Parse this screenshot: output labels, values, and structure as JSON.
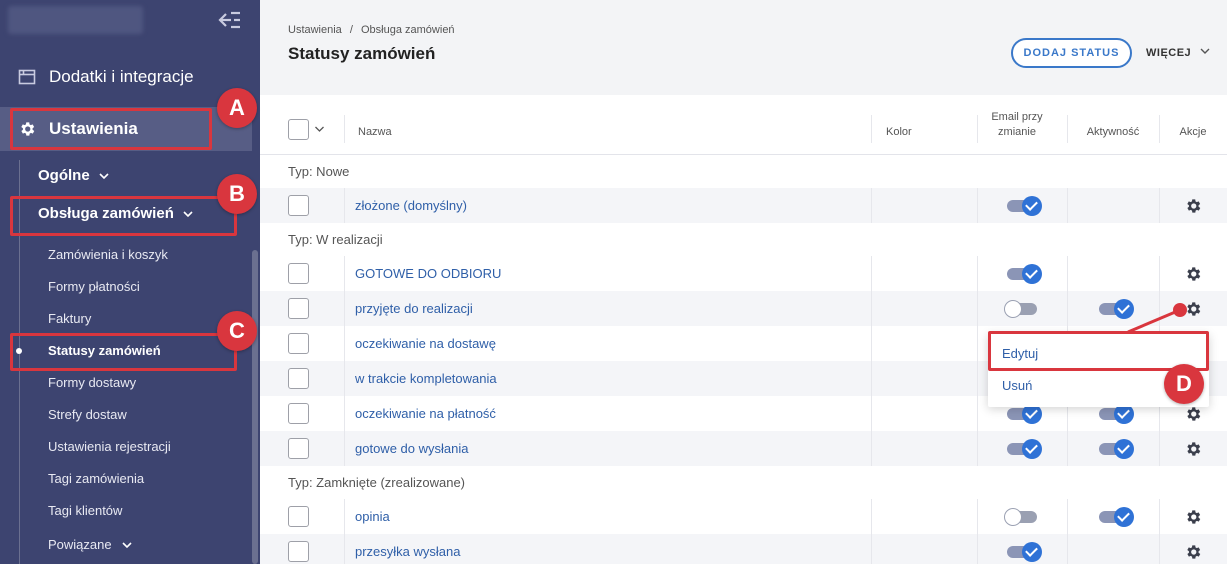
{
  "sidebar": {
    "main_items": [
      {
        "label": "Dodatki i integracje",
        "icon": "calendar-icon"
      },
      {
        "label": "Ustawienia",
        "icon": "gear-icon"
      }
    ],
    "sub_items": [
      {
        "label": "Ogólne"
      },
      {
        "label": "Obsługa zamówień"
      }
    ],
    "leaf_items": [
      "Zamówienia i koszyk",
      "Formy płatności",
      "Faktury",
      "Statusy zamówień",
      "Formy dostawy",
      "Strefy dostaw",
      "Ustawienia rejestracji",
      "Tagi zamówienia",
      "Tagi klientów",
      "Powiązane"
    ],
    "active_leaf": "Statusy zamówień"
  },
  "header": {
    "breadcrumb": [
      "Ustawienia",
      "Obsługa zamówień"
    ],
    "breadcrumb_sep": "/",
    "title": "Statusy zamówień",
    "add_button": "DODAJ STATUS",
    "more_button": "WIĘCEJ"
  },
  "table": {
    "columns": {
      "name": "Nazwa",
      "color": "Kolor",
      "email_line1": "Email przy",
      "email_line2": "zmianie",
      "active": "Aktywność",
      "actions": "Akcje"
    },
    "groups": [
      {
        "type_label": "Typ: Nowe",
        "rows": [
          {
            "name": "złożone (domyślny)",
            "email": "on",
            "active": "disabled"
          }
        ]
      },
      {
        "type_label": "Typ: W realizacji",
        "rows": [
          {
            "name": "GOTOWE DO ODBIORU",
            "email": "on",
            "active": "disabled"
          },
          {
            "name": "przyjęte do realizacji",
            "email": "off",
            "active": "on"
          },
          {
            "name": "oczekiwanie na dostawę",
            "email": "on",
            "active": "on"
          },
          {
            "name": "w trakcie kompletowania",
            "email": "on",
            "active": "on"
          },
          {
            "name": "oczekiwanie na płatność",
            "email": "on",
            "active": "on"
          },
          {
            "name": "gotowe do wysłania",
            "email": "on",
            "active": "on"
          }
        ]
      },
      {
        "type_label": "Typ: Zamknięte (zrealizowane)",
        "rows": [
          {
            "name": "opinia",
            "email": "off",
            "active": "on"
          },
          {
            "name": "przesyłka wysłana",
            "email": "on",
            "active": "disabled"
          }
        ]
      }
    ]
  },
  "context_menu": {
    "edit": "Edytuj",
    "delete": "Usuń"
  },
  "badges": [
    "A",
    "B",
    "C",
    "D"
  ],
  "colors": {
    "sidebar": "#3d4470",
    "accent": "#2f72d6",
    "highlight": "#d9363e",
    "link": "#2f5fa8"
  }
}
